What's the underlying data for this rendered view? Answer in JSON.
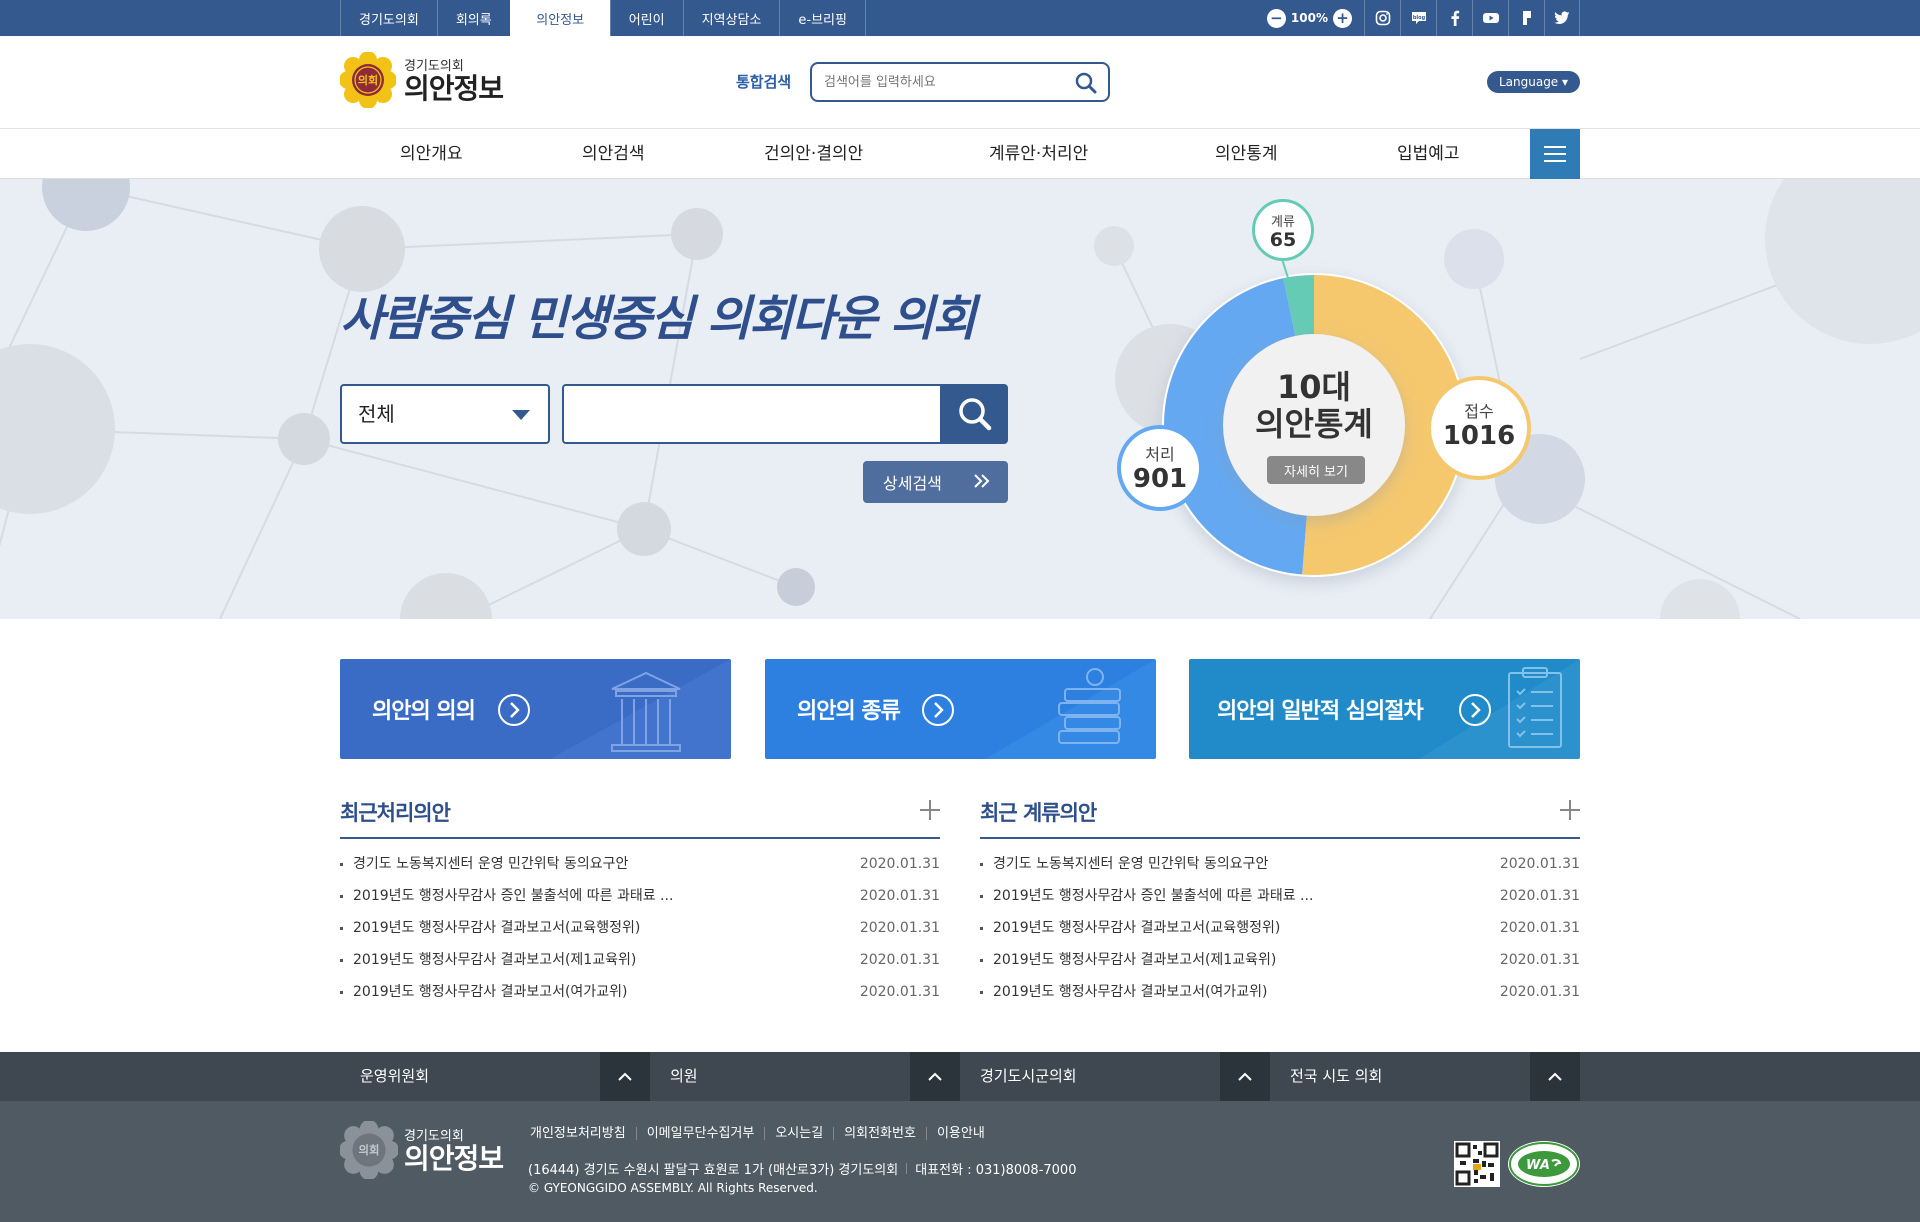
{
  "topbar": {
    "tabs": [
      "경기도의회",
      "회의록",
      "의안정보",
      "어린이",
      "지역상담소",
      "e-브리핑"
    ],
    "active_tab": 2,
    "zoom": "100%",
    "zoom_out_icon": "minus-icon",
    "zoom_in_icon": "plus-icon",
    "sns": [
      "instagram-icon",
      "blog-icon",
      "facebook-icon",
      "youtube-icon",
      "kakao-icon",
      "twitter-icon"
    ]
  },
  "header": {
    "logo_emblem_text": "의회",
    "logo_sub": "경기도의회",
    "logo_main": "의안정보",
    "search_label": "통합검색",
    "search_placeholder": "검색어를 입력하세요",
    "language_label": "Language ▾"
  },
  "gnb": {
    "items": [
      "의안개요",
      "의안검색",
      "건의안·결의안",
      "계류안·처리안",
      "의안통계",
      "입법예고"
    ]
  },
  "hero": {
    "slogan": "사람중심 민생중심 의회다운 의회",
    "select_value": "전체",
    "detail_search": "상세검색"
  },
  "stats": {
    "center_title_line1": "10대",
    "center_title_line2": "의안통계",
    "detail_button": "자세히 보기",
    "items": [
      {
        "label": "접수",
        "value": 1016,
        "color": "#f5c86e"
      },
      {
        "label": "처리",
        "value": 901,
        "color": "#64a8f1"
      },
      {
        "label": "계류",
        "value": 65,
        "color": "#66cbb5"
      }
    ]
  },
  "banners": [
    {
      "title": "의안의 의의",
      "color": "#3a6cc6"
    },
    {
      "title": "의안의 종류",
      "color": "#2d80e0"
    },
    {
      "title": "의안의 일반적 심의절차",
      "color": "#218ac8"
    }
  ],
  "recent_processed": {
    "title": "최근처리의안",
    "items": [
      {
        "title": "경기도 노동복지센터 운영 민간위탁 동의요구안",
        "date": "2020.01.31"
      },
      {
        "title": "2019년도 행정사무감사 증인 불출석에 따른 과태료 ...",
        "date": "2020.01.31"
      },
      {
        "title": "2019년도 행정사무감사 결과보고서(교육행정위)",
        "date": "2020.01.31"
      },
      {
        "title": "2019년도 행정사무감사 결과보고서(제1교육위)",
        "date": "2020.01.31"
      },
      {
        "title": "2019년도 행정사무감사 결과보고서(여가교위)",
        "date": "2020.01.31"
      }
    ]
  },
  "recent_pending": {
    "title": "최근 계류의안",
    "items": [
      {
        "title": "경기도 노동복지센터 운영 민간위탁 동의요구안",
        "date": "2020.01.31"
      },
      {
        "title": "2019년도 행정사무감사 증인 불출석에 따른 과태료 ...",
        "date": "2020.01.31"
      },
      {
        "title": "2019년도 행정사무감사 결과보고서(교육행정위)",
        "date": "2020.01.31"
      },
      {
        "title": "2019년도 행정사무감사 결과보고서(제1교육위)",
        "date": "2020.01.31"
      },
      {
        "title": "2019년도 행정사무감사 결과보고서(여가교위)",
        "date": "2020.01.31"
      }
    ]
  },
  "footer_nav": [
    "운영위원회",
    "의원",
    "경기도시군의회",
    "전국 시도 의회"
  ],
  "footer": {
    "logo_emblem_text": "의회",
    "logo_sub": "경기도의회",
    "logo_main": "의안정보",
    "links": [
      "개인정보처리방침",
      "이메일무단수집거부",
      "오시는길",
      "의회전화번호",
      "이용안내"
    ],
    "address": "(16444) 경기도 수원시 팔달구 효원로 1가 (매산로3가) 경기도의회",
    "phone": "대표전화 : 031)8008-7000",
    "copyright": "© GYEONGGIDO ASSEMBLY. All Rights Reserved."
  }
}
